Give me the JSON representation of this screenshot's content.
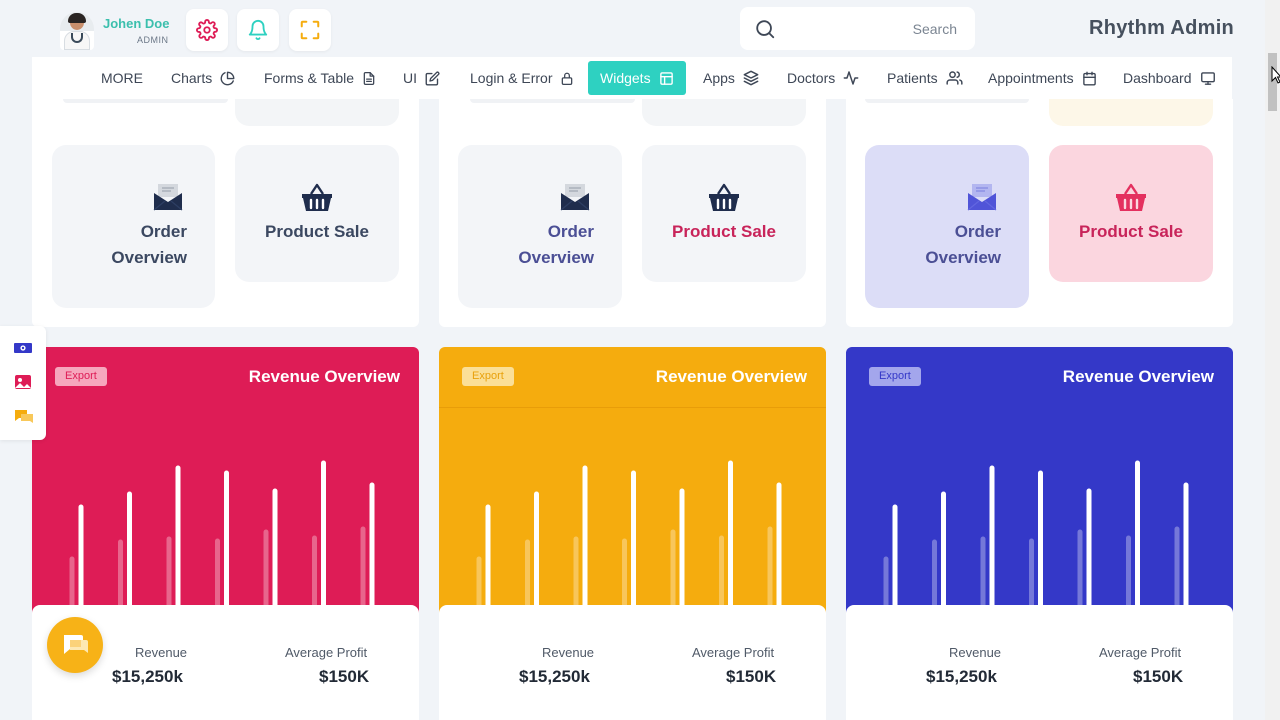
{
  "header": {
    "user_name": "Johen Doe",
    "user_role": "ADMIN",
    "search_placeholder": "Search",
    "brand": "Rhythm Admin",
    "icons": [
      "gear-icon",
      "bell-icon",
      "fullscreen-icon"
    ]
  },
  "nav": {
    "items": [
      {
        "label": "MORE",
        "icon": ""
      },
      {
        "label": "Charts",
        "icon": "pie-chart-icon"
      },
      {
        "label": "Forms & Table",
        "icon": "document-icon"
      },
      {
        "label": "UI",
        "icon": "edit-icon"
      },
      {
        "label": "Login & Error",
        "icon": "lock-icon"
      },
      {
        "label": "Widgets",
        "icon": "layout-icon",
        "active": true
      },
      {
        "label": "Apps",
        "icon": "layers-icon"
      },
      {
        "label": "Doctors",
        "icon": "activity-icon"
      },
      {
        "label": "Patients",
        "icon": "users-icon"
      },
      {
        "label": "Appointments",
        "icon": "calendar-icon"
      },
      {
        "label": "Dashboard",
        "icon": "monitor-icon"
      }
    ]
  },
  "widget_panels": [
    {
      "order_overview": {
        "line1": "Order",
        "line2": "Overview",
        "icon": "envelope-icon"
      },
      "product_sale": {
        "label": "Product Sale",
        "icon": "basket-icon"
      }
    },
    {
      "order_overview": {
        "line1": "Order",
        "line2": "Overview",
        "icon": "envelope-icon"
      },
      "product_sale": {
        "label": "Product Sale",
        "icon": "basket-icon"
      }
    },
    {
      "order_overview": {
        "line1": "Order",
        "line2": "Overview",
        "icon": "envelope-icon"
      },
      "product_sale": {
        "label": "Product Sale",
        "icon": "basket-icon"
      }
    }
  ],
  "revenue_cards": [
    {
      "export_label": "Export",
      "title": "Revenue Overview",
      "revenue_label": "Revenue",
      "revenue_value": "$15,250k",
      "profit_label": "Average Profit",
      "profit_value": "$150K",
      "color": "#de1c56"
    },
    {
      "export_label": "Export",
      "title": "Revenue Overview",
      "revenue_label": "Revenue",
      "revenue_value": "$15,250k",
      "profit_label": "Average Profit",
      "profit_value": "$150K",
      "color": "#f5ac0e"
    },
    {
      "export_label": "Export",
      "title": "Revenue Overview",
      "revenue_label": "Revenue",
      "revenue_value": "$15,250k",
      "profit_label": "Average Profit",
      "profit_value": "$150K",
      "color": "#3438c8"
    }
  ],
  "colors": {
    "accent": "#2ed1c1",
    "pink": "#de1c56",
    "amber": "#f5ac0e",
    "indigo": "#3438c8",
    "navy": "#1f2d4d"
  },
  "chart_data": {
    "type": "bar",
    "series": [
      {
        "values": [
          100,
          113,
          139,
          134,
          116,
          144,
          122
        ]
      },
      {
        "values": [
          48,
          65,
          68,
          66,
          75,
          69,
          78
        ]
      }
    ]
  },
  "side_dock": {
    "icons": [
      "money-icon",
      "image-icon",
      "chat-icon"
    ]
  },
  "chat_fab": {
    "icon": "chat-bubble-icon"
  }
}
